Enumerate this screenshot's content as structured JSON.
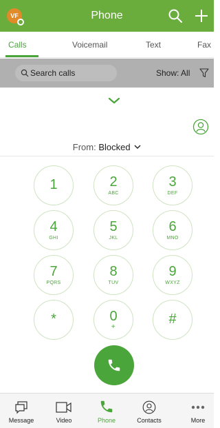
{
  "header": {
    "avatar_initials": "VF",
    "title": "Phone",
    "icons": [
      "search-icon",
      "plus-icon"
    ]
  },
  "tabs": [
    {
      "label": "Calls",
      "active": true
    },
    {
      "label": "Voicemail",
      "active": false
    },
    {
      "label": "Text",
      "active": false
    },
    {
      "label": "Fax",
      "active": false
    }
  ],
  "filter": {
    "search_placeholder": "Search calls",
    "show_label": "Show: All"
  },
  "from": {
    "label": "From:",
    "value": "Blocked"
  },
  "keypad": [
    {
      "digit": "1",
      "letters": ""
    },
    {
      "digit": "2",
      "letters": "ABC"
    },
    {
      "digit": "3",
      "letters": "DEF"
    },
    {
      "digit": "4",
      "letters": "GHI"
    },
    {
      "digit": "5",
      "letters": "JKL"
    },
    {
      "digit": "6",
      "letters": "MNO"
    },
    {
      "digit": "7",
      "letters": "PQRS"
    },
    {
      "digit": "8",
      "letters": "TUV"
    },
    {
      "digit": "9",
      "letters": "WXYZ"
    },
    {
      "digit": "*",
      "letters": ""
    },
    {
      "digit": "0",
      "letters": "+"
    },
    {
      "digit": "#",
      "letters": ""
    }
  ],
  "bottom_nav": [
    {
      "label": "Message",
      "icon": "message-icon",
      "active": false
    },
    {
      "label": "Video",
      "icon": "video-icon",
      "active": false
    },
    {
      "label": "Phone",
      "icon": "phone-icon",
      "active": true
    },
    {
      "label": "Contacts",
      "icon": "contacts-icon",
      "active": false
    },
    {
      "label": "More",
      "icon": "more-icon",
      "active": false
    }
  ],
  "colors": {
    "brand_green": "#6aad3d",
    "accent_green": "#4aa53a",
    "avatar_orange": "#e08a2a"
  }
}
